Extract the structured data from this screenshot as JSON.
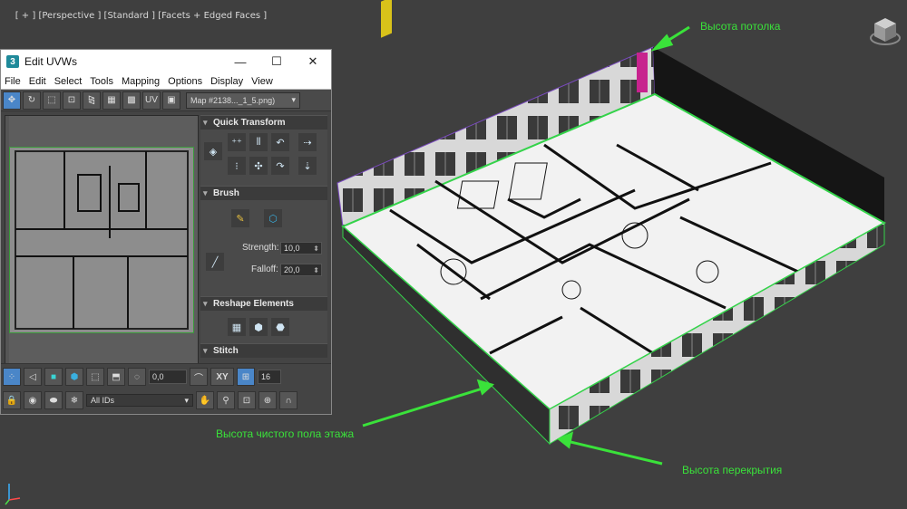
{
  "viewport": {
    "labels": [
      "[ + ]",
      "[Perspective ]",
      "[Standard ]",
      "[Facets + Edged Faces ]"
    ]
  },
  "annotations": {
    "ceiling": "Высота потолка",
    "floor": "Высота чистого пола этажа",
    "slab": "Высота перекрытия"
  },
  "uvw_window": {
    "title": "Edit UVWs",
    "app_icon": "3",
    "window_buttons": [
      "—",
      "☐",
      "✕"
    ],
    "menu": [
      "File",
      "Edit",
      "Select",
      "Tools",
      "Mapping",
      "Options",
      "Display",
      "View"
    ],
    "uv_label": "UV",
    "map_select": "Map #2138..._1_5.png)",
    "rollouts": {
      "quick_transform": "Quick Transform",
      "brush": "Brush",
      "strength_label": "Strength:",
      "strength_value": "10,0",
      "falloff_label": "Falloff:",
      "falloff_value": "20,0",
      "reshape": "Reshape Elements",
      "stitch": "Stitch"
    },
    "bottom": {
      "value_field": "0,0",
      "xy_label": "XY",
      "grid_value": "16",
      "ids_select": "All IDs"
    }
  },
  "colors": {
    "annotation": "#3ae23a",
    "viewport_bg": "#3f3f3f",
    "active_button": "#4a86c8"
  }
}
